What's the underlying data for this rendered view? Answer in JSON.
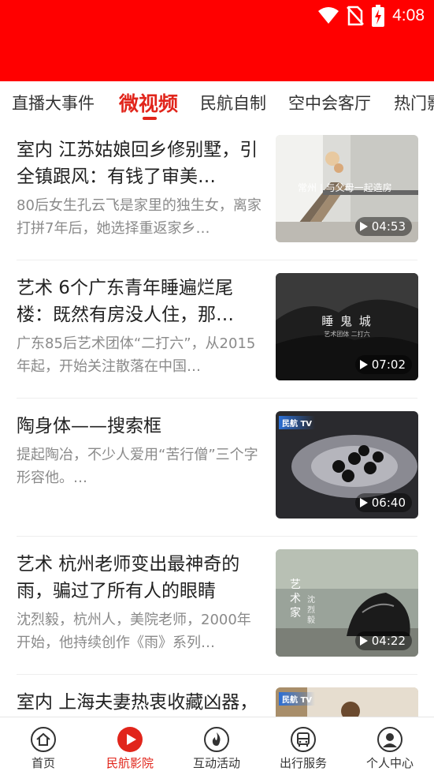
{
  "status": {
    "time": "4:08"
  },
  "tabs": [
    {
      "label": "直播大事件"
    },
    {
      "label": "微视频",
      "active": true
    },
    {
      "label": "民航自制"
    },
    {
      "label": "空中会客厅"
    },
    {
      "label": "热门影"
    }
  ],
  "articles": [
    {
      "title": "室内 江苏姑娘回乡修别墅，引全镇跟风：有钱了审美…",
      "desc": "80后女生孔云飞是家里的独生女，离家打拼7年后，她选择重返家乡…",
      "duration": "04:53",
      "thumb_text": "常州 | 与父母一起造房"
    },
    {
      "title": "艺术 6个广东青年睡遍烂尾楼：既然有房没人住，那…",
      "desc": "广东85后艺术团体“二打六”，从2015年起，开始关注散落在中国…",
      "duration": "07:02",
      "thumb_text": "睡 鬼 城",
      "thumb_subtext": "艺术团体 二打六"
    },
    {
      "title": "陶身体——搜索框",
      "desc": "提起陶冶，不少人爱用“苦行僧”三个字形容他。…",
      "duration": "06:40",
      "thumb_logo": "民航 TV"
    },
    {
      "title": "艺术 杭州老师变出最神奇的雨，骗过了所有人的眼睛",
      "desc": "沈烈毅，杭州人，美院老师，2000年开始，他持续创作《雨》系列…",
      "duration": "04:22",
      "thumb_text": "艺术家",
      "thumb_subtext": "沈烈毅"
    },
    {
      "title": "室内 上海夫妻热衷收藏凶器，用长羊做软装，每天…",
      "desc": "",
      "duration": "",
      "thumb_logo": "民航 TV"
    }
  ],
  "bottom_nav": [
    {
      "label": "首页",
      "icon": "home-icon"
    },
    {
      "label": "民航影院",
      "icon": "play-circle-icon",
      "active": true
    },
    {
      "label": "互动活动",
      "icon": "flame-icon"
    },
    {
      "label": "出行服务",
      "icon": "bus-icon"
    },
    {
      "label": "个人中心",
      "icon": "user-icon"
    }
  ],
  "colors": {
    "brand_red": "#ff0000",
    "accent": "#e1251b",
    "text": "#222222",
    "muted": "#8a8a8a"
  }
}
